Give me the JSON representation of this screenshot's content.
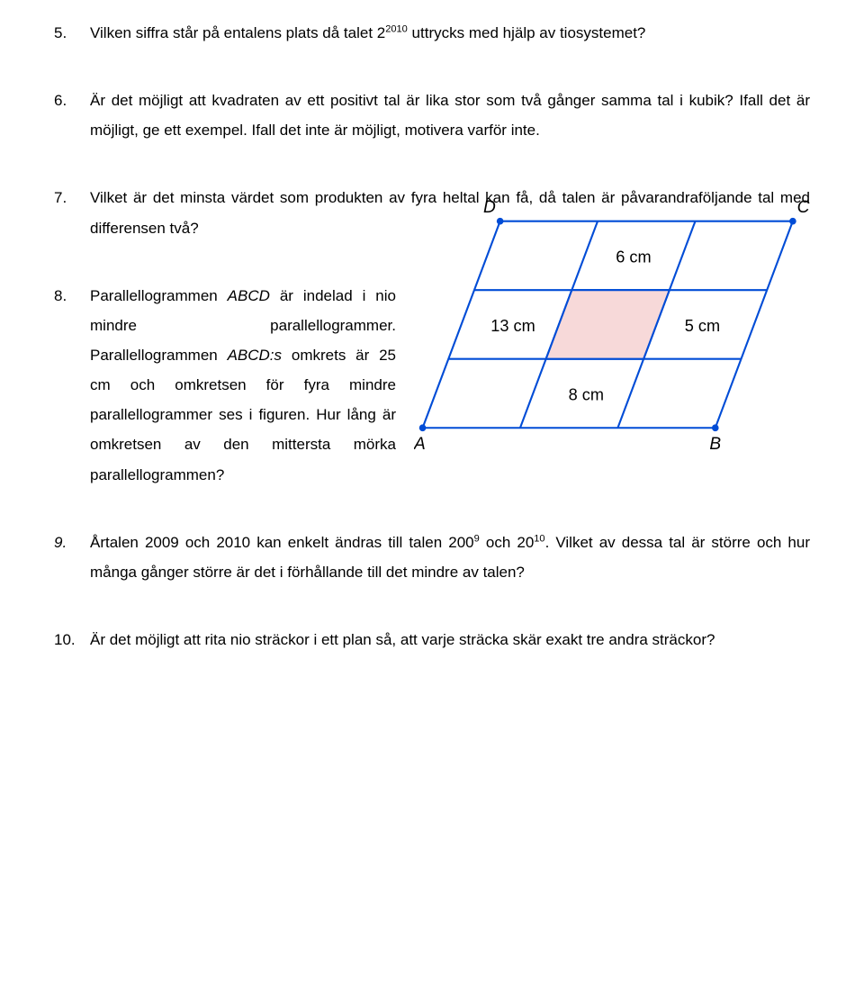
{
  "problems": {
    "p5": {
      "num": "5.",
      "pre": "Vilken siffra står på entalens plats då talet 2",
      "exp": "2010",
      "post": " uttrycks med hjälp av tiosystemet?"
    },
    "p6": {
      "num": "6.",
      "text": "Är det möjligt att kvadraten av ett positivt tal är lika stor som två gånger samma tal i kubik? Ifall det är möjligt, ge ett exempel. Ifall det inte är möjligt, motivera varför inte."
    },
    "p7": {
      "num": "7.",
      "text": "Vilket är det minsta värdet som produkten av fyra heltal kan få, då talen är påvarandraföljande tal med differensen två?"
    },
    "p8": {
      "num": "8.",
      "t1": "Parallellogrammen ",
      "abcd1": "ABCD",
      "t2": " är indelad i nio mindre parallellogrammer. Parallellogrammen ",
      "abcd2": "ABCD:s",
      "t3": " omkrets är 25 cm och omkretsen för fyra mindre parallellogrammer ses i figuren. Hur lång är omkretsen av den mittersta mörka parallellogrammen?"
    },
    "p9": {
      "num": "9.",
      "t1": "Årtalen 2009 och 2010 kan enkelt ändras till talen 200",
      "e1": "9",
      "t2": " och 20",
      "e2": "10",
      "t3": ". Vilket av dessa tal är större och hur många gånger större är det i förhållande till det mindre av talen?"
    },
    "p10": {
      "num": "10.",
      "text": "Är det möjligt att rita nio sträckor i ett plan så, att varje sträcka skär exakt tre andra sträckor?"
    }
  },
  "diagram": {
    "D": "D",
    "C": "C",
    "A": "A",
    "B": "B",
    "l6": "6 cm",
    "l13": "13 cm",
    "l5": "5 cm",
    "l8": "8 cm"
  }
}
